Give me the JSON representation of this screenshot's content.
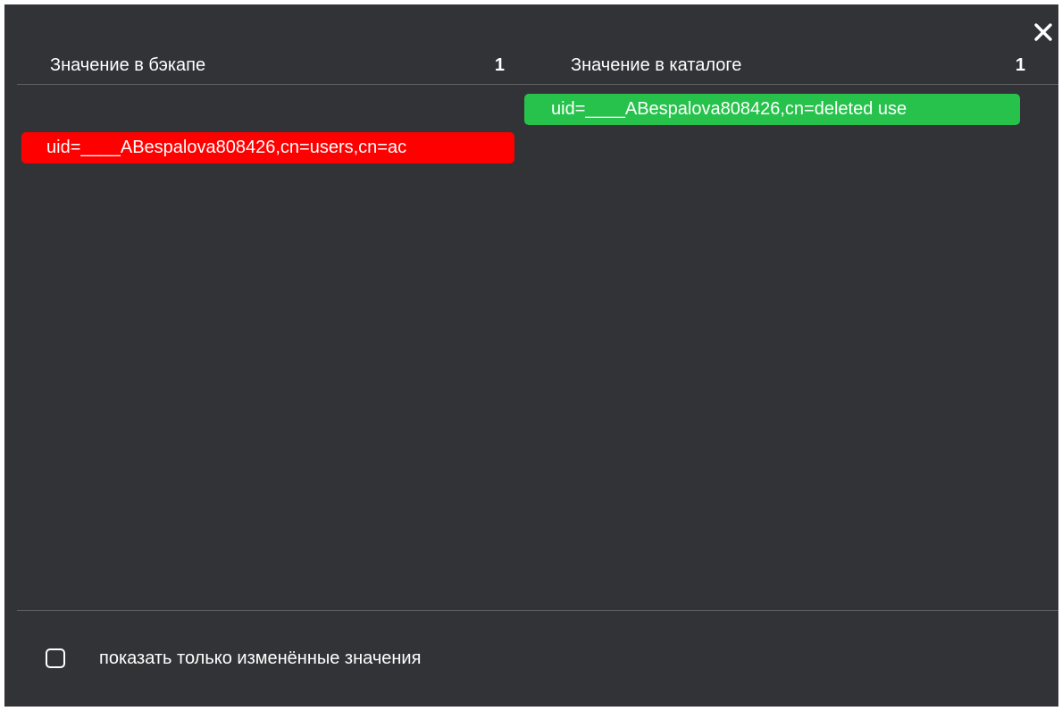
{
  "header": {
    "backup_label": "Значение в бэкапе",
    "backup_count": "1",
    "catalog_label": "Значение в каталоге",
    "catalog_count": "1"
  },
  "close_icon": "close-icon",
  "backup_values": [
    {
      "text": "uid=____ABespalova808426,cn=users,cn=ac",
      "status_color": "#ff0000"
    }
  ],
  "catalog_values": [
    {
      "text": "uid=____ABespalova808426,cn=deleted use",
      "status_color": "#27c24c"
    }
  ],
  "footer": {
    "show_changed_label": "показать только изменённые значения",
    "show_changed_checked": false
  },
  "colors": {
    "background": "#323337",
    "removed": "#ff0000",
    "added": "#27c24c"
  }
}
